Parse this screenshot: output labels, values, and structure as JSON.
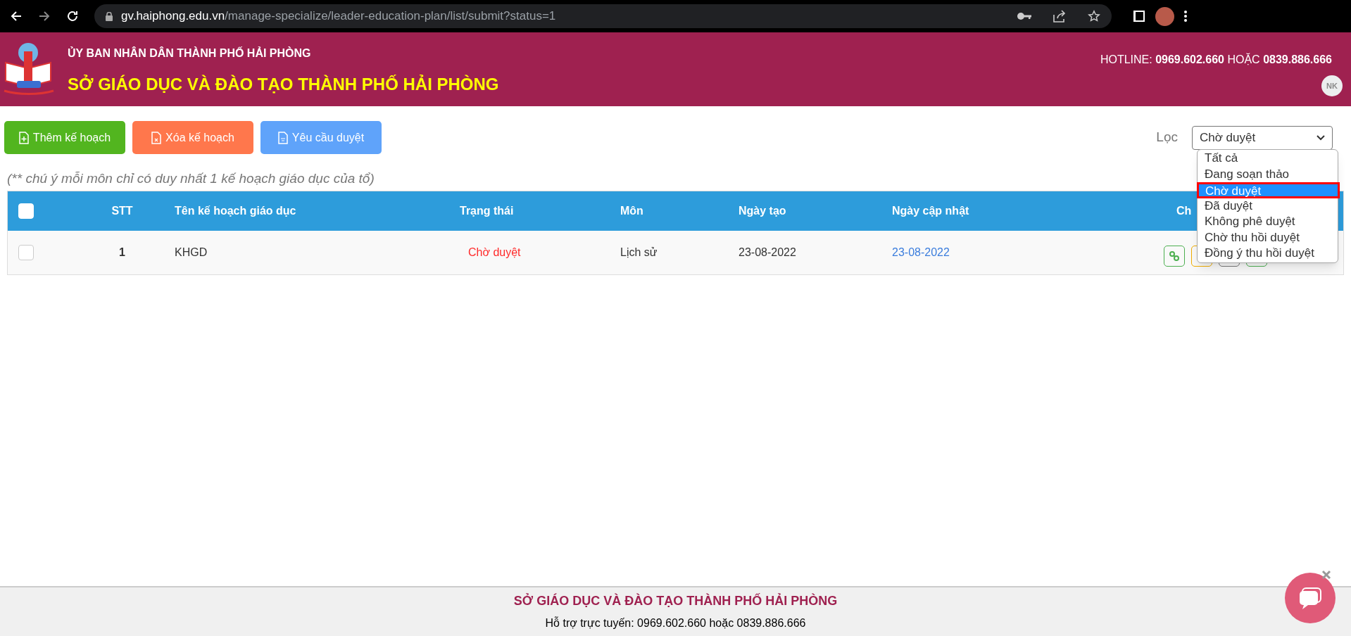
{
  "browser": {
    "url_host": "gv.haiphong.edu.vn",
    "url_path": "/manage-specialize/leader-education-plan/list/submit?status=1"
  },
  "header": {
    "org": "ỦY BAN NHÂN DÂN THÀNH PHỐ HẢI PHÒNG",
    "title": "SỞ GIÁO DỤC VÀ ĐÀO TẠO THÀNH PHỐ HẢI PHÒNG",
    "hotline": "HOTLINE: **0969.602.660** HOẶC **0839.886.666**",
    "user_initials": "NK"
  },
  "toolbar": [
    {
      "kind": "add",
      "label": "Thêm kế hoạch"
    },
    {
      "kind": "delete",
      "label": "Xóa kế hoạch"
    },
    {
      "kind": "request",
      "label": "Yêu cầu duyệt"
    }
  ],
  "filter": {
    "label": "Lọc",
    "value": "Chờ duyệt",
    "expanded": true,
    "options": [
      {
        "label": "Tất cả",
        "selected": false
      },
      {
        "label": "Đang soạn thảo",
        "selected": false
      },
      {
        "label": "Chờ duyệt",
        "selected": true
      },
      {
        "label": "Đã duyệt",
        "selected": false
      },
      {
        "label": "Không phê duyệt",
        "selected": false
      },
      {
        "label": "Chờ thu hồi duyệt",
        "selected": false
      },
      {
        "label": "Đồng ý thu hồi duyệt",
        "selected": false
      }
    ]
  },
  "note": "(** chú ý mỗi môn chỉ có duy nhất 1 kế hoạch giáo dục của tổ)",
  "table": {
    "header_checked": false,
    "columns": [
      "STT",
      "Tên kế hoạch giáo dục",
      "Trạng thái",
      "Môn",
      "Ngày tạo",
      "Ngày cập nhật",
      "Ch"
    ],
    "rows": [
      {
        "checked": false,
        "stt": "1",
        "name": "KHGD",
        "status": "Chờ duyệt",
        "subject": "Lịch sử",
        "created": "23-08-2022",
        "updated": "23-08-2022"
      }
    ]
  },
  "footer": {
    "title": "SỞ GIÁO DỤC VÀ ĐÀO TẠO THÀNH PHỐ HẢI PHÒNG",
    "support": "Hỗ trợ trực tuyến: 0969.602.660 hoặc 0839.886.666"
  }
}
